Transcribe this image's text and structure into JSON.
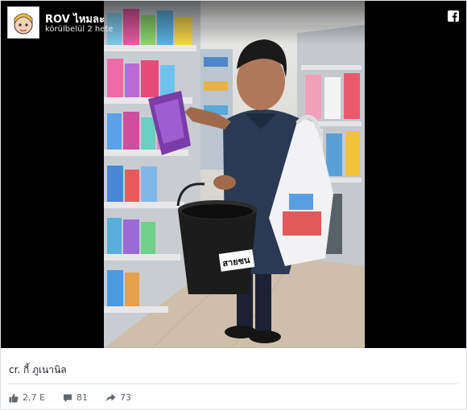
{
  "post": {
    "page_name": "ROV ไหมละ",
    "time": "körülbelül 2 hete",
    "caption": "cr. กี้ ภูเนานิล",
    "bucket_label": "สายชน"
  },
  "stats": {
    "likes": "2,7 E",
    "comments": "81",
    "shares": "73"
  },
  "icons": {
    "brand": "facebook-icon",
    "like": "thumbs-up-icon",
    "comment": "comment-bubble-icon",
    "share": "share-arrow-icon"
  },
  "colors": {
    "video_bg": "#000000",
    "text": "#1d2129",
    "muted": "#606770"
  }
}
